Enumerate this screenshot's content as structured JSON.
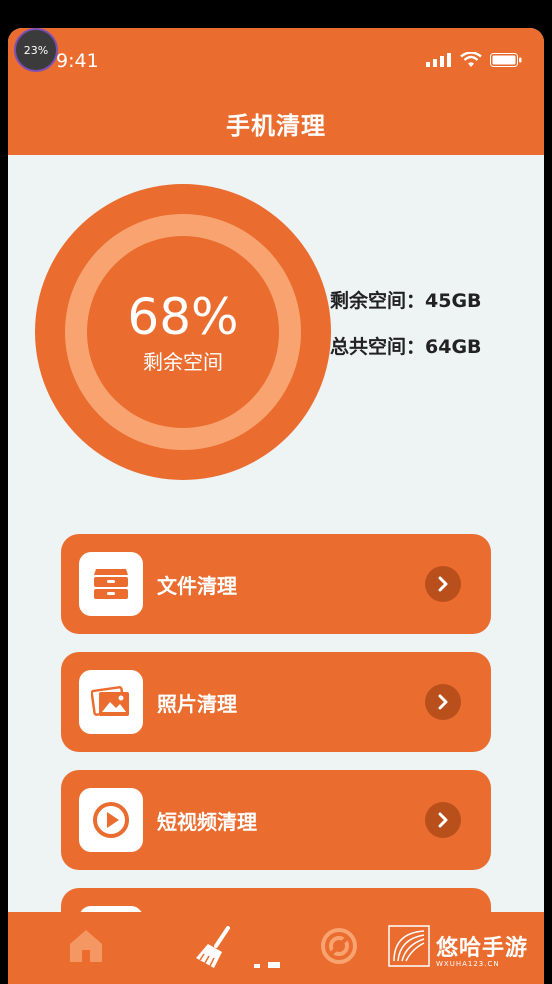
{
  "status_bar": {
    "time": "9:41",
    "badge": "23%",
    "icons": [
      "signal-icon",
      "wifi-icon",
      "battery-icon"
    ]
  },
  "header": {
    "title": "手机清理"
  },
  "storage": {
    "percent_text": "68%",
    "percent_value": 68,
    "ring_label": "剩余空间",
    "remaining_label": "剩余空间：45GB",
    "total_label": "总共空间：64GB"
  },
  "menu": {
    "items": [
      {
        "label": "文件清理",
        "icon": "drawer-icon"
      },
      {
        "label": "照片清理",
        "icon": "photos-icon"
      },
      {
        "label": "短视频清理",
        "icon": "play-icon"
      }
    ]
  },
  "tabbar": {
    "tabs": [
      "home-icon",
      "broom-icon",
      "refresh-icon",
      "more-icon"
    ]
  },
  "watermark": {
    "text": "悠哈手游",
    "sub": "WXUHA123.CN"
  },
  "colors": {
    "accent": "#ea6c2f",
    "accent_light": "#f8a370",
    "background": "#eef3f4"
  }
}
